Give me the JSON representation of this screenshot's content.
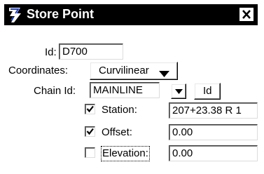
{
  "window": {
    "title": "Store Point",
    "icon": "bentley-b-icon",
    "close_icon": "close-x-icon"
  },
  "form": {
    "id_label": "Id:",
    "id_value": "D700",
    "coordinates_label": "Coordinates:",
    "coordinates_selected": "Curvilinear",
    "chain_id_label": "Chain Id:",
    "chain_id_value": "MAINLINE",
    "chain_id_button_label": "Id",
    "station": {
      "label": "Station:",
      "checked": true,
      "value": "207+23.38 R 1"
    },
    "offset": {
      "label": "Offset:",
      "checked": true,
      "value": "0.00"
    },
    "elevation": {
      "label": "Elevation:",
      "checked": false,
      "value": "0.00"
    }
  },
  "colors": {
    "titlebar": "#000000",
    "background": "#ffffff"
  }
}
